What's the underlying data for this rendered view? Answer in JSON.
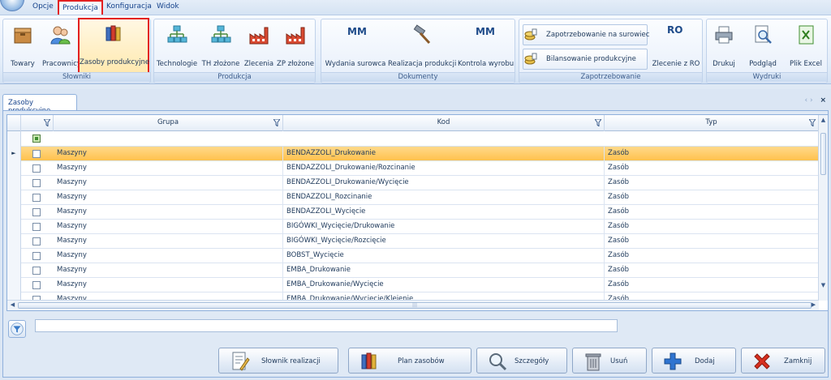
{
  "menubar": {
    "items": [
      {
        "label": "Opcje"
      },
      {
        "label": "Produkcja"
      },
      {
        "label": "Konfiguracja"
      },
      {
        "label": "Widok"
      }
    ]
  },
  "ribbon": {
    "groups": [
      {
        "label": "Słowniki",
        "buttons": [
          "Towary",
          "Pracownicy",
          "Zasoby produkcyjne"
        ]
      },
      {
        "label": "Produkcja",
        "buttons": [
          "Technologie",
          "TH złożone",
          "Zlecenia",
          "ZP złożone"
        ]
      },
      {
        "label": "Dokumenty",
        "buttons": [
          "Wydania surowca",
          "Realizacja produkcji",
          "Kontrola wyrobu"
        ],
        "mm_label": "MM"
      },
      {
        "label": "Zapotrzebowanie",
        "small_buttons": [
          "Zapotrzebowanie na surowiec",
          "Bilansowanie produkcyjne"
        ],
        "buttons": [
          "Zlecenie z RO"
        ],
        "ro_label": "RO"
      },
      {
        "label": "Wydruki",
        "buttons": [
          "Drukuj",
          "Podgląd",
          "Plik Excel"
        ]
      }
    ]
  },
  "doc_tab": {
    "label": "Zasoby produkcyjne",
    "prev": "‹",
    "next": "›",
    "close": "×"
  },
  "grid": {
    "columns": [
      "Grupa",
      "Kod",
      "Typ"
    ],
    "selected_indicator": "►",
    "rows": [
      {
        "grupa": "Maszyny",
        "kod": "BENDAZZOLI_Drukowanie",
        "typ": "Zasób"
      },
      {
        "grupa": "Maszyny",
        "kod": "BENDAZZOLI_Drukowanie/Rozcinanie",
        "typ": "Zasób"
      },
      {
        "grupa": "Maszyny",
        "kod": "BENDAZZOLI_Drukowanie/Wycięcie",
        "typ": "Zasób"
      },
      {
        "grupa": "Maszyny",
        "kod": "BENDAZZOLI_Rozcinanie",
        "typ": "Zasób"
      },
      {
        "grupa": "Maszyny",
        "kod": "BENDAZZOLI_Wycięcie",
        "typ": "Zasób"
      },
      {
        "grupa": "Maszyny",
        "kod": "BIGÓWKI_Wycięcie/Drukowanie",
        "typ": "Zasób"
      },
      {
        "grupa": "Maszyny",
        "kod": "BIGÓWKI_Wycięcie/Rozcięcie",
        "typ": "Zasób"
      },
      {
        "grupa": "Maszyny",
        "kod": "BOBST_Wycięcie",
        "typ": "Zasób"
      },
      {
        "grupa": "Maszyny",
        "kod": "EMBA_Drukowanie",
        "typ": "Zasób"
      },
      {
        "grupa": "Maszyny",
        "kod": "EMBA_Drukowanie/Wycięcie",
        "typ": "Zasób"
      },
      {
        "grupa": "Maszyny",
        "kod": "EMBA_Drukowanie/Wycięcie/Klejenie",
        "typ": "Zasób"
      }
    ]
  },
  "filter": {
    "value": ""
  },
  "buttons": {
    "slownik": "Słownik realizacji",
    "plan": "Plan zasobów",
    "szczegoly": "Szczegóły",
    "usun": "Usuń",
    "dodaj": "Dodaj",
    "zamknij": "Zamknij"
  },
  "colors": {
    "accent_red": "#e32020",
    "selection": "#ffc14d",
    "ribbon_bg": "#e3edf9"
  }
}
